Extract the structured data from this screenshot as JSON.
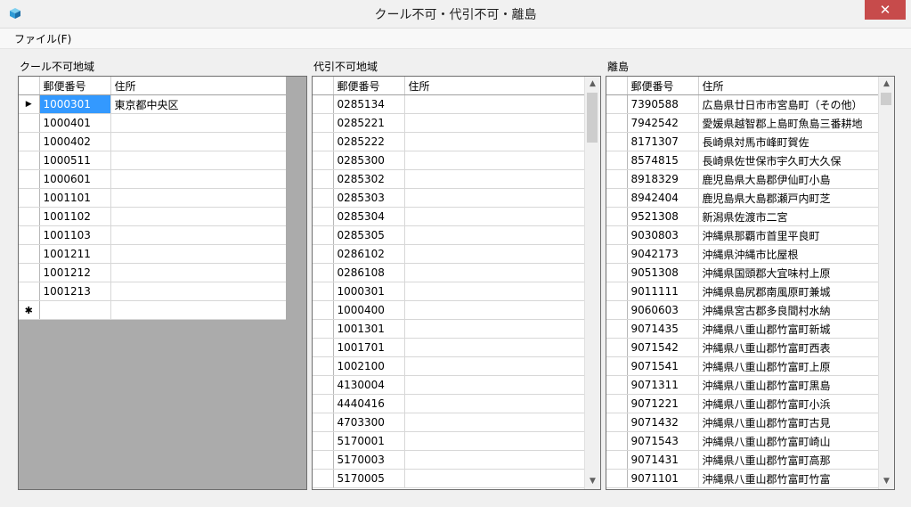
{
  "window": {
    "title": "クール不可・代引不可・離島",
    "close_glyph": "✕"
  },
  "menu": {
    "file": "ファイル(F)"
  },
  "grids": {
    "cool": {
      "label": "クール不可地域",
      "headers": [
        "郵便番号",
        "住所"
      ],
      "rows": [
        {
          "code": "1000301",
          "addr": "東京都中央区"
        },
        {
          "code": "1000401",
          "addr": ""
        },
        {
          "code": "1000402",
          "addr": ""
        },
        {
          "code": "1000511",
          "addr": ""
        },
        {
          "code": "1000601",
          "addr": ""
        },
        {
          "code": "1001101",
          "addr": ""
        },
        {
          "code": "1001102",
          "addr": ""
        },
        {
          "code": "1001103",
          "addr": ""
        },
        {
          "code": "1001211",
          "addr": ""
        },
        {
          "code": "1001212",
          "addr": ""
        },
        {
          "code": "1001213",
          "addr": ""
        }
      ],
      "current_row_glyph": "▶",
      "new_row_glyph": "✱"
    },
    "cod": {
      "label": "代引不可地域",
      "headers": [
        "郵便番号",
        "住所"
      ],
      "rows": [
        {
          "code": "0285134",
          "addr": ""
        },
        {
          "code": "0285221",
          "addr": ""
        },
        {
          "code": "0285222",
          "addr": ""
        },
        {
          "code": "0285300",
          "addr": ""
        },
        {
          "code": "0285302",
          "addr": ""
        },
        {
          "code": "0285303",
          "addr": ""
        },
        {
          "code": "0285304",
          "addr": ""
        },
        {
          "code": "0285305",
          "addr": ""
        },
        {
          "code": "0286102",
          "addr": ""
        },
        {
          "code": "0286108",
          "addr": ""
        },
        {
          "code": "1000301",
          "addr": ""
        },
        {
          "code": "1000400",
          "addr": ""
        },
        {
          "code": "1001301",
          "addr": ""
        },
        {
          "code": "1001701",
          "addr": ""
        },
        {
          "code": "1002100",
          "addr": ""
        },
        {
          "code": "4130004",
          "addr": ""
        },
        {
          "code": "4440416",
          "addr": ""
        },
        {
          "code": "4703300",
          "addr": ""
        },
        {
          "code": "5170001",
          "addr": ""
        },
        {
          "code": "5170003",
          "addr": ""
        },
        {
          "code": "5170005",
          "addr": ""
        }
      ]
    },
    "island": {
      "label": "離島",
      "headers": [
        "郵便番号",
        "住所"
      ],
      "rows": [
        {
          "code": "7390588",
          "addr": "広島県廿日市市宮島町（その他）"
        },
        {
          "code": "7942542",
          "addr": "愛媛県越智郡上島町魚島三番耕地"
        },
        {
          "code": "8171307",
          "addr": "長崎県対馬市峰町賀佐"
        },
        {
          "code": "8574815",
          "addr": "長崎県佐世保市宇久町大久保"
        },
        {
          "code": "8918329",
          "addr": "鹿児島県大島郡伊仙町小島"
        },
        {
          "code": "8942404",
          "addr": "鹿児島県大島郡瀬戸内町芝"
        },
        {
          "code": "9521308",
          "addr": "新潟県佐渡市二宮"
        },
        {
          "code": "9030803",
          "addr": "沖縄県那覇市首里平良町"
        },
        {
          "code": "9042173",
          "addr": "沖縄県沖縄市比屋根"
        },
        {
          "code": "9051308",
          "addr": "沖縄県国頭郡大宜味村上原"
        },
        {
          "code": "9011111",
          "addr": "沖縄県島尻郡南風原町兼城"
        },
        {
          "code": "9060603",
          "addr": "沖縄県宮古郡多良間村水納"
        },
        {
          "code": "9071435",
          "addr": "沖縄県八重山郡竹富町新城"
        },
        {
          "code": "9071542",
          "addr": "沖縄県八重山郡竹富町西表"
        },
        {
          "code": "9071541",
          "addr": "沖縄県八重山郡竹富町上原"
        },
        {
          "code": "9071311",
          "addr": "沖縄県八重山郡竹富町黒島"
        },
        {
          "code": "9071221",
          "addr": "沖縄県八重山郡竹富町小浜"
        },
        {
          "code": "9071432",
          "addr": "沖縄県八重山郡竹富町古見"
        },
        {
          "code": "9071543",
          "addr": "沖縄県八重山郡竹富町崎山"
        },
        {
          "code": "9071431",
          "addr": "沖縄県八重山郡竹富町高那"
        },
        {
          "code": "9071101",
          "addr": "沖縄県八重山郡竹富町竹富"
        }
      ]
    }
  },
  "scroll": {
    "up_glyph": "▲",
    "down_glyph": "▼"
  },
  "colors": {
    "selection": "#3399ff",
    "empty_area": "#ababab",
    "close_button": "#c74b4b"
  }
}
